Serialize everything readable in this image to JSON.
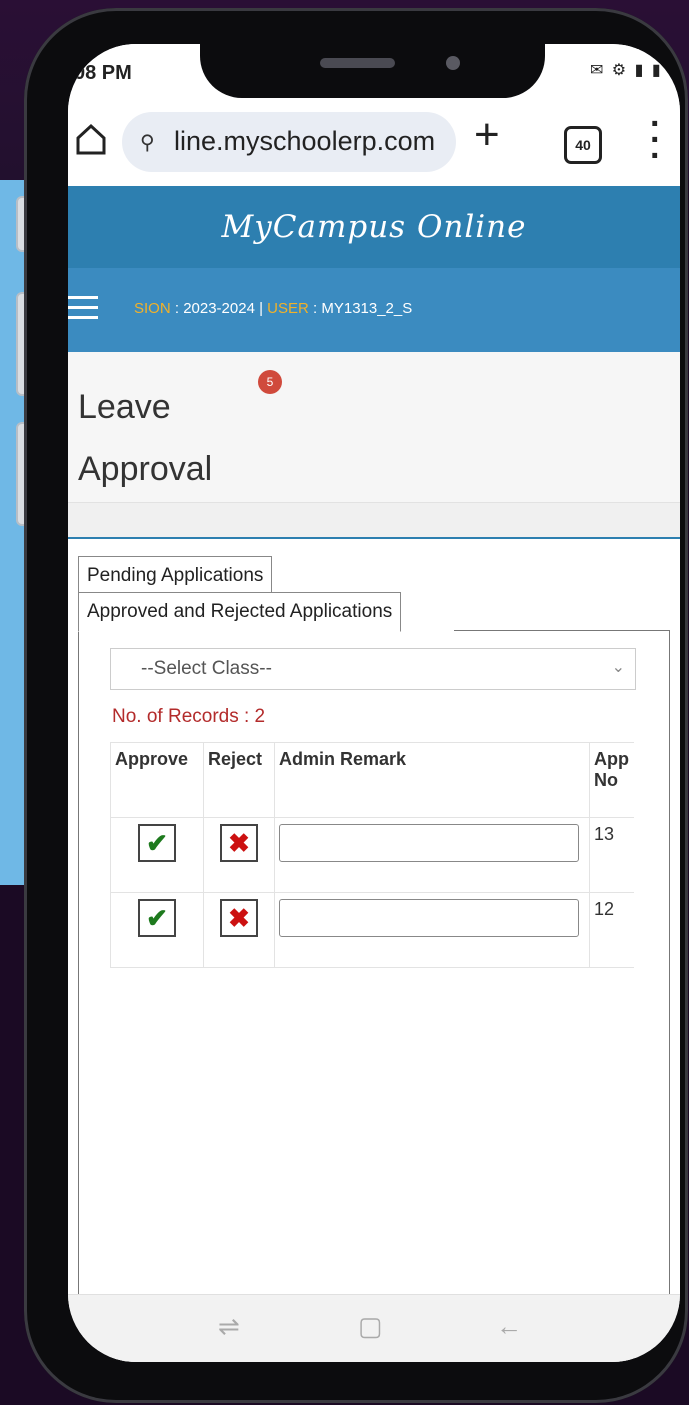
{
  "status_bar": {
    "time": "08 PM",
    "icons": "✉ ⚙ ▮ ▮ 6"
  },
  "browser": {
    "url": "line.myschoolerp.com",
    "tab_count": "40"
  },
  "app": {
    "title": "MyCampus Online"
  },
  "session_bar": {
    "session_label": "SION",
    "session_value": " : 2023-2024 | ",
    "user_label": "USER",
    "user_value": " : MY1313_2_S"
  },
  "page": {
    "title_line1": "Leave",
    "title_line2": "Approval",
    "badge_count": "5"
  },
  "tabs": {
    "pending": "Pending Applications",
    "approved_rejected": "Approved and Rejected Applications"
  },
  "filter": {
    "select_value": "--Select Class--"
  },
  "records": {
    "label": "No. of Records : 2"
  },
  "table": {
    "headers": {
      "approve": "Approve",
      "reject": "Reject",
      "remark": "Admin Remark",
      "app_no_1": "App",
      "app_no_2": "No"
    },
    "rows": [
      {
        "app_no": "13",
        "remark": ""
      },
      {
        "app_no": "12",
        "remark": ""
      }
    ]
  },
  "colors": {
    "header": "#2d7fb0",
    "subbar": "#3b8bc0",
    "accent_label": "#f0b12a",
    "records": "#b32b2b",
    "approve": "#1e7a1e",
    "reject": "#cc1111"
  }
}
